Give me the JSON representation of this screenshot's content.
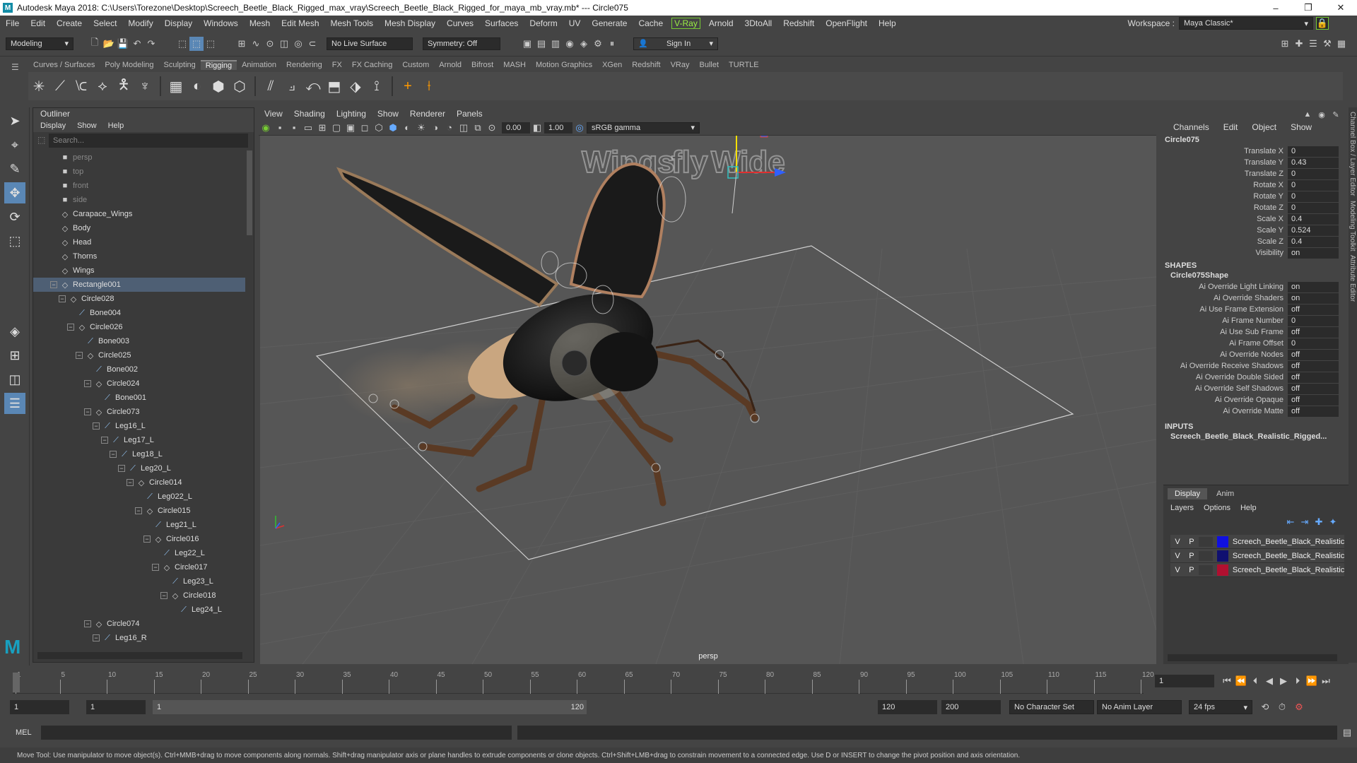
{
  "titlebar": {
    "title": "Autodesk Maya 2018: C:\\Users\\Torezone\\Desktop\\Screech_Beetle_Black_Rigged_max_vray\\Screech_Beetle_Black_Rigged_for_maya_mb_vray.mb*   ---   Circle075",
    "minimize": "–",
    "maximize": "❐",
    "close": "✕"
  },
  "menubar": {
    "items": [
      "File",
      "Edit",
      "Create",
      "Select",
      "Modify",
      "Display",
      "Windows",
      "Mesh",
      "Edit Mesh",
      "Mesh Tools",
      "Mesh Display",
      "Curves",
      "Surfaces",
      "Deform",
      "UV",
      "Generate",
      "Cache"
    ],
    "vray": "V-Ray",
    "items2": [
      "Arnold",
      "3DtoAll",
      "Redshift",
      "OpenFlight",
      "Help"
    ],
    "workspace_label": "Workspace :",
    "workspace_value": "Maya Classic*"
  },
  "statusline": {
    "mode": "Modeling",
    "live_surface": "No Live Surface",
    "symmetry": "Symmetry: Off",
    "sign_in": "Sign In"
  },
  "shelf": {
    "tabs": [
      "Curves / Surfaces",
      "Poly Modeling",
      "Sculpting",
      "Rigging",
      "Animation",
      "Rendering",
      "FX",
      "FX Caching",
      "Custom",
      "Arnold",
      "Bifrost",
      "MASH",
      "Motion Graphics",
      "XGen",
      "Redshift",
      "VRay",
      "Bullet",
      "TURTLE"
    ],
    "active": "Rigging"
  },
  "outliner": {
    "title": "Outliner",
    "menu": [
      "Display",
      "Show",
      "Help"
    ],
    "search_placeholder": "Search...",
    "nodes": [
      {
        "label": "persp",
        "depth": 0,
        "toggle": "",
        "icon": "■",
        "cam": true
      },
      {
        "label": "top",
        "depth": 0,
        "toggle": "",
        "icon": "■",
        "cam": true
      },
      {
        "label": "front",
        "depth": 0,
        "toggle": "",
        "icon": "■",
        "cam": true
      },
      {
        "label": "side",
        "depth": 0,
        "toggle": "",
        "icon": "■",
        "cam": true
      },
      {
        "label": "Carapace_Wings",
        "depth": 0,
        "toggle": "",
        "icon": "◇"
      },
      {
        "label": "Body",
        "depth": 0,
        "toggle": "",
        "icon": "◇"
      },
      {
        "label": "Head",
        "depth": 0,
        "toggle": "",
        "icon": "◇"
      },
      {
        "label": "Thorns",
        "depth": 0,
        "toggle": "",
        "icon": "◇"
      },
      {
        "label": "Wings",
        "depth": 0,
        "toggle": "",
        "icon": "◇"
      },
      {
        "label": "Rectangle001",
        "depth": 0,
        "toggle": "−",
        "icon": "◇",
        "sel": true
      },
      {
        "label": "Circle028",
        "depth": 1,
        "toggle": "−",
        "icon": "◇"
      },
      {
        "label": "Bone004",
        "depth": 2,
        "toggle": "",
        "icon": "⟋"
      },
      {
        "label": "Circle026",
        "depth": 2,
        "toggle": "−",
        "icon": "◇"
      },
      {
        "label": "Bone003",
        "depth": 3,
        "toggle": "",
        "icon": "⟋"
      },
      {
        "label": "Circle025",
        "depth": 3,
        "toggle": "−",
        "icon": "◇"
      },
      {
        "label": "Bone002",
        "depth": 4,
        "toggle": "",
        "icon": "⟋"
      },
      {
        "label": "Circle024",
        "depth": 4,
        "toggle": "−",
        "icon": "◇"
      },
      {
        "label": "Bone001",
        "depth": 5,
        "toggle": "",
        "icon": "⟋"
      },
      {
        "label": "Circle073",
        "depth": 4,
        "toggle": "−",
        "icon": "◇"
      },
      {
        "label": "Leg16_L",
        "depth": 5,
        "toggle": "−",
        "icon": "⟋"
      },
      {
        "label": "Leg17_L",
        "depth": 6,
        "toggle": "−",
        "icon": "⟋"
      },
      {
        "label": "Leg18_L",
        "depth": 7,
        "toggle": "−",
        "icon": "⟋"
      },
      {
        "label": "Leg20_L",
        "depth": 8,
        "toggle": "−",
        "icon": "⟋"
      },
      {
        "label": "Circle014",
        "depth": 9,
        "toggle": "−",
        "icon": "◇"
      },
      {
        "label": "Leg022_L",
        "depth": 10,
        "toggle": "",
        "icon": "⟋"
      },
      {
        "label": "Circle015",
        "depth": 10,
        "toggle": "−",
        "icon": "◇"
      },
      {
        "label": "Leg21_L",
        "depth": 11,
        "toggle": "",
        "icon": "⟋"
      },
      {
        "label": "Circle016",
        "depth": 11,
        "toggle": "−",
        "icon": "◇"
      },
      {
        "label": "Leg22_L",
        "depth": 12,
        "toggle": "",
        "icon": "⟋"
      },
      {
        "label": "Circle017",
        "depth": 12,
        "toggle": "−",
        "icon": "◇"
      },
      {
        "label": "Leg23_L",
        "depth": 13,
        "toggle": "",
        "icon": "⟋"
      },
      {
        "label": "Circle018",
        "depth": 13,
        "toggle": "−",
        "icon": "◇"
      },
      {
        "label": "Leg24_L",
        "depth": 14,
        "toggle": "",
        "icon": "⟋"
      },
      {
        "label": "Circle074",
        "depth": 4,
        "toggle": "−",
        "icon": "◇"
      },
      {
        "label": "Leg16_R",
        "depth": 5,
        "toggle": "−",
        "icon": "⟋"
      }
    ]
  },
  "viewport": {
    "menu": [
      "View",
      "Shading",
      "Lighting",
      "Show",
      "Renderer",
      "Panels"
    ],
    "near": "0.00",
    "far": "1.00",
    "colorspace": "sRGB gamma",
    "camera_label": "persp",
    "text_wings": "Wings",
    "text_fly": "fly",
    "text_wide": "Wide"
  },
  "channelbox": {
    "menu": [
      "Channels",
      "Edit",
      "Object",
      "Show"
    ],
    "object": "Circle075",
    "attrs": [
      {
        "name": "Translate X",
        "value": "0"
      },
      {
        "name": "Translate Y",
        "value": "0.43"
      },
      {
        "name": "Translate Z",
        "value": "0"
      },
      {
        "name": "Rotate X",
        "value": "0"
      },
      {
        "name": "Rotate Y",
        "value": "0"
      },
      {
        "name": "Rotate Z",
        "value": "0"
      },
      {
        "name": "Scale X",
        "value": "0.4"
      },
      {
        "name": "Scale Y",
        "value": "0.524"
      },
      {
        "name": "Scale Z",
        "value": "0.4"
      },
      {
        "name": "Visibility",
        "value": "on"
      }
    ],
    "shapes_title": "SHAPES",
    "shape_name": "Circle075Shape",
    "shape_attrs": [
      {
        "name": "Ai Override Light Linking",
        "value": "on"
      },
      {
        "name": "Ai Override Shaders",
        "value": "on"
      },
      {
        "name": "Ai Use Frame Extension",
        "value": "off"
      },
      {
        "name": "Ai Frame Number",
        "value": "0"
      },
      {
        "name": "Ai Use Sub Frame",
        "value": "off"
      },
      {
        "name": "Ai Frame Offset",
        "value": "0"
      },
      {
        "name": "Ai Override Nodes",
        "value": "off"
      },
      {
        "name": "Ai Override Receive Shadows",
        "value": "off"
      },
      {
        "name": "Ai Override Double Sided",
        "value": "off"
      },
      {
        "name": "Ai Override Self Shadows",
        "value": "off"
      },
      {
        "name": "Ai Override Opaque",
        "value": "off"
      },
      {
        "name": "Ai Override Matte",
        "value": "off"
      }
    ],
    "inputs_title": "INPUTS",
    "input_name": "Screech_Beetle_Black_Realistic_Rigged..."
  },
  "layers": {
    "tabs": [
      "Display",
      "Anim"
    ],
    "menu": [
      "Layers",
      "Options",
      "Help"
    ],
    "rows": [
      {
        "v": "V",
        "p": "P",
        "color": "#1010e0",
        "name": "Screech_Beetle_Black_Realistic"
      },
      {
        "v": "V",
        "p": "P",
        "color": "#101070",
        "name": "Screech_Beetle_Black_Realistic"
      },
      {
        "v": "V",
        "p": "P",
        "color": "#b01030",
        "name": "Screech_Beetle_Black_Realistic"
      }
    ]
  },
  "sidetabs": [
    "Channel Box / Layer Editor",
    "Modeling Toolkit",
    "Attribute Editor"
  ],
  "timeline": {
    "ticks": [
      "1",
      "5",
      "10",
      "15",
      "20",
      "25",
      "30",
      "35",
      "40",
      "45",
      "50",
      "55",
      "60",
      "65",
      "70",
      "75",
      "80",
      "85",
      "90",
      "95",
      "100",
      "105",
      "110",
      "115",
      "120"
    ],
    "current_frame": "1"
  },
  "range": {
    "start": "1",
    "playback_start": "1",
    "slider_start": "1",
    "slider_end": "120",
    "playback_end": "120",
    "end": "200",
    "character_set": "No Character Set",
    "anim_layer": "No Anim Layer",
    "fps": "24 fps"
  },
  "cmdline": {
    "label": "MEL"
  },
  "helpline": {
    "text": "Move Tool: Use manipulator to move object(s). Ctrl+MMB+drag to move components along normals. Shift+drag manipulator axis or plane handles to extrude components or clone objects. Ctrl+Shift+LMB+drag to constrain movement to a connected edge. Use D or INSERT to change the pivot position and axis orientation."
  }
}
